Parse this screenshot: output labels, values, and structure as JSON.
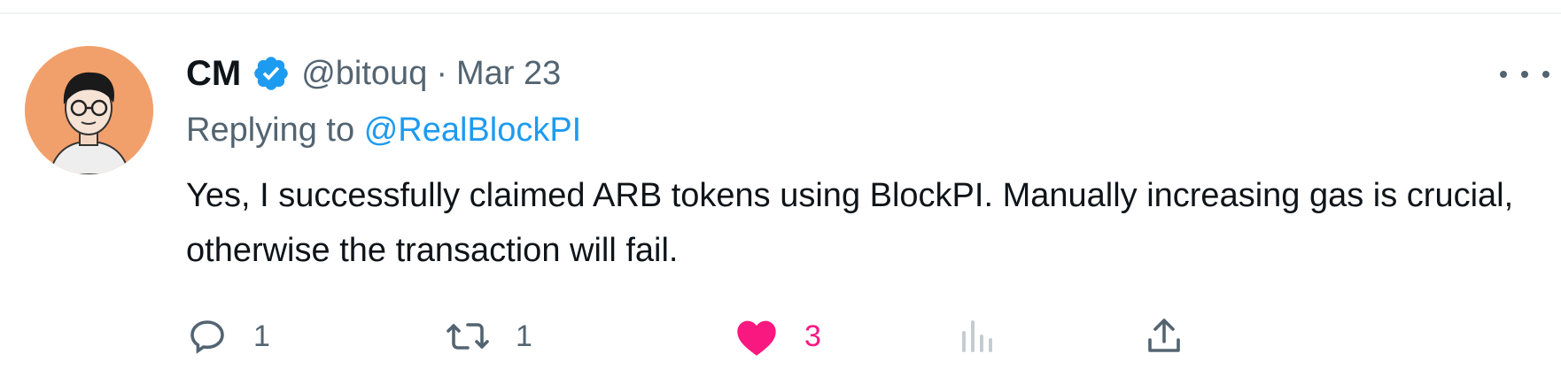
{
  "tweet": {
    "display_name": "CM",
    "handle": "@bitouq",
    "separator": "·",
    "date": "Mar 23",
    "replying_prefix": "Replying to",
    "replying_to": "@RealBlockPI",
    "text": "Yes, I successfully claimed ARB tokens using BlockPI. Manually increasing gas is crucial, otherwise the transaction will fail.",
    "verified": true
  },
  "actions": {
    "reply": {
      "icon": "reply-icon",
      "count": "1"
    },
    "retweet": {
      "icon": "retweet-icon",
      "count": "1"
    },
    "like": {
      "icon": "heart-icon",
      "count": "3",
      "liked": true
    },
    "views": {
      "icon": "views-icon"
    },
    "share": {
      "icon": "share-icon"
    }
  },
  "colors": {
    "text": "#0f1419",
    "secondary": "#536471",
    "link": "#1d9bf0",
    "like": "#f91880",
    "verified": "#1d9bf0",
    "avatar_bg": "#f2a06b"
  }
}
